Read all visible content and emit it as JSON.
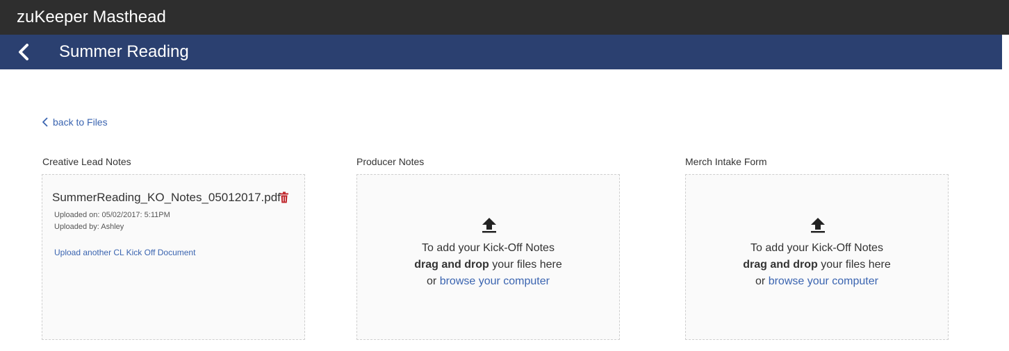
{
  "masthead": {
    "title": "zuKeeper Masthead"
  },
  "header": {
    "title": "Summer Reading",
    "back_icon": "chevron-left-icon"
  },
  "nav": {
    "back_link": "back to Files"
  },
  "columns": [
    {
      "label": "Creative Lead Notes",
      "file": {
        "name": "SummerReading_KO_Notes_05012017.pdf",
        "uploaded_on": "Uploaded on: 05/02/2017: 5:11PM",
        "uploaded_by": "Uploaded by: Ashley",
        "upload_another": "Upload another CL Kick Off Document"
      }
    },
    {
      "label": "Producer Notes",
      "dropzone": {
        "line1": "To add your Kick-Off Notes",
        "drag_bold": "drag and drop",
        "drag_rest": " your files here",
        "or": "or ",
        "browse": "browse your computer"
      }
    },
    {
      "label": "Merch Intake Form",
      "dropzone": {
        "line1": "To add your Kick-Off Notes",
        "drag_bold": "drag and drop",
        "drag_rest": " your files here",
        "or": "or ",
        "browse": "browse your computer"
      }
    }
  ],
  "colors": {
    "masthead": "#2e2e2e",
    "titlebar": "#2b4070",
    "link": "#3a64b0",
    "delete": "#c0282d"
  }
}
